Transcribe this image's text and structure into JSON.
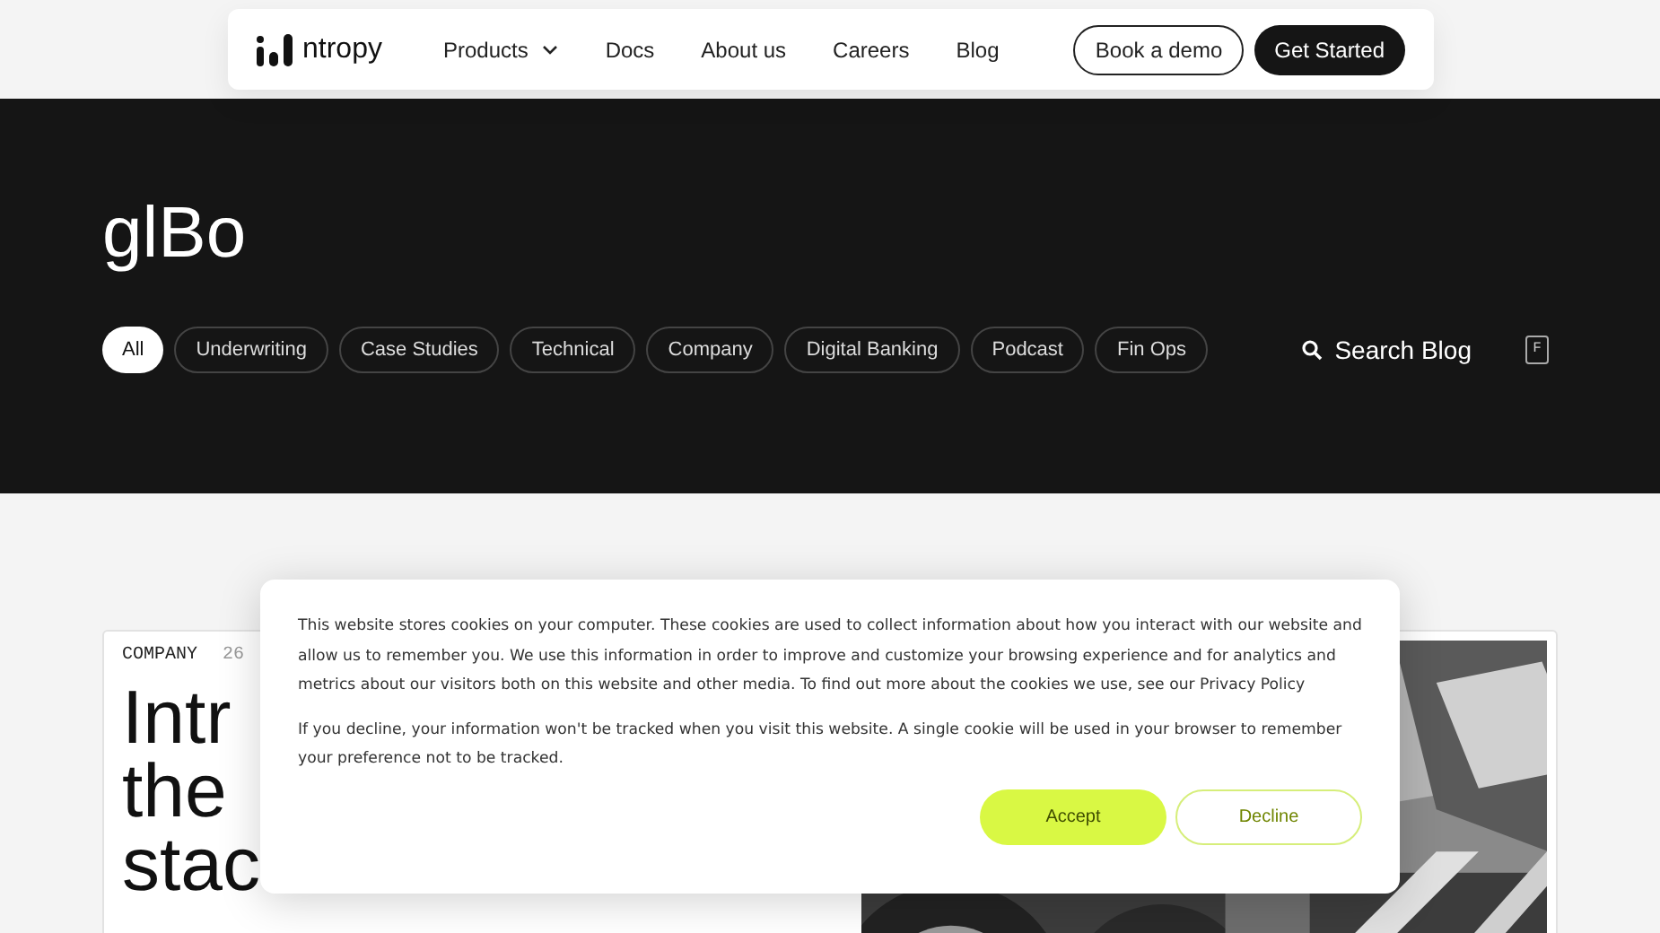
{
  "nav": {
    "logo": "ntropy",
    "links": [
      {
        "label": "Products",
        "kind": "dropdown"
      },
      {
        "label": "Docs",
        "kind": "link"
      },
      {
        "label": "About us",
        "kind": "link"
      },
      {
        "label": "Careers",
        "kind": "link"
      },
      {
        "label": "Blog",
        "kind": "link"
      }
    ],
    "buttons": [
      {
        "label": "Book a demo",
        "kind": "outline"
      },
      {
        "label": "Get Started",
        "kind": "solid"
      }
    ]
  },
  "hero": {
    "title": "glBo",
    "filters": [
      {
        "label": "All",
        "selected": true
      },
      {
        "label": "Underwriting",
        "selected": false
      },
      {
        "label": "Case Studies",
        "selected": false
      },
      {
        "label": "Technical",
        "selected": false
      },
      {
        "label": "Company",
        "selected": false
      },
      {
        "label": "Digital Banking",
        "selected": false
      },
      {
        "label": "Podcast",
        "selected": false
      },
      {
        "label": "Fin Ops",
        "selected": false
      }
    ],
    "search": {
      "label": "Search Blog",
      "shortcut": "F"
    }
  },
  "post": {
    "category": "COMPANY",
    "date": "26",
    "headline_lines": [
      "Intr",
      "the",
      "stac"
    ]
  },
  "cookie_banner": {
    "paragraphs": [
      "This website stores cookies on your computer. These cookies are used to collect information about how you interact with our website and allow us to remember you. We use this information in order to improve and customize your browsing experience and for analytics and metrics about our visitors both on this website and other media. To find out more about the cookies we use, see our Privacy Policy",
      "If you decline, your information won't be tracked when you visit this website. A single cookie will be used in your browser to remember your preference not to be tracked."
    ],
    "buttons": [
      {
        "label": "Accept",
        "kind": "solid"
      },
      {
        "label": "Decline",
        "kind": "outline"
      }
    ]
  }
}
